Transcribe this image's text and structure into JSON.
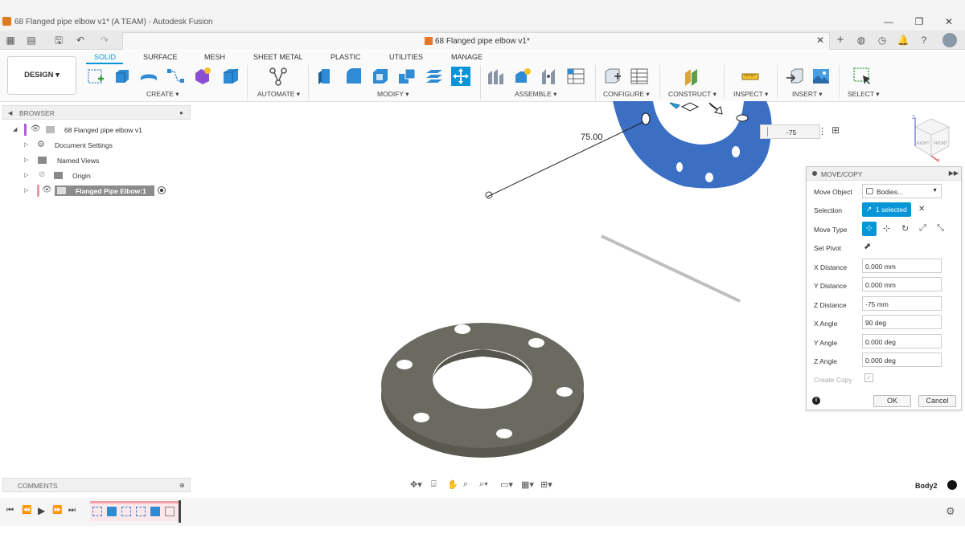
{
  "window": {
    "title": "68 Flanged pipe elbow v1* (A TEAM) - Autodesk Fusion",
    "controls": [
      "—",
      "❐",
      "✕"
    ]
  },
  "document_tab": {
    "title": "68 Flanged pipe elbow v1*"
  },
  "ribbon": {
    "workspace_button": "DESIGN ▾",
    "tabs": [
      "SOLID",
      "SURFACE",
      "MESH",
      "SHEET METAL",
      "PLASTIC",
      "UTILITIES",
      "MANAGE"
    ],
    "active_tab": "SOLID",
    "groups": [
      "CREATE ▾",
      "AUTOMATE ▾",
      "MODIFY ▾",
      "ASSEMBLE ▾",
      "CONFIGURE ▾",
      "CONSTRUCT ▾",
      "INSPECT ▾",
      "INSERT ▾",
      "SELECT ▾"
    ]
  },
  "browser": {
    "header": "BROWSER",
    "items": [
      {
        "label": "68 Flanged pipe elbow v1"
      },
      {
        "label": "Document Settings"
      },
      {
        "label": "Named Views"
      },
      {
        "label": "Origin"
      },
      {
        "label": "Flanged Pipe Elbow:1"
      }
    ]
  },
  "comments": {
    "header": "COMMENTS"
  },
  "viewport": {
    "dimension_label": "75.00",
    "z_input_value": "-75",
    "status_body": "Body2",
    "viewcube_labels": [
      "RIGHT",
      "FRONT"
    ],
    "axis_labels": {
      "z": "Z",
      "x": "X"
    }
  },
  "move_copy": {
    "title": "MOVE/COPY",
    "fields": {
      "move_object_label": "Move Object",
      "move_object_value": "Bodies...",
      "selection_label": "Selection",
      "selection_value": "1 selected",
      "move_type_label": "Move Type",
      "set_pivot_label": "Set Pivot",
      "x_distance_label": "X Distance",
      "x_distance_value": "0.000 mm",
      "y_distance_label": "Y Distance",
      "y_distance_value": "0.000 mm",
      "z_distance_label": "Z Distance",
      "z_distance_value": "-75 mm",
      "x_angle_label": "X Angle",
      "x_angle_value": "90 deg",
      "y_angle_label": "Y Angle",
      "y_angle_value": "0.000 deg",
      "z_angle_label": "Z Angle",
      "z_angle_value": "0.000 deg",
      "create_copy_label": "Create Copy"
    },
    "ok_label": "OK",
    "cancel_label": "Cancel"
  },
  "colors": {
    "accent": "#0696d7",
    "flange_blue": "#3a6fc4",
    "flange_grey": "#6b6a61"
  }
}
